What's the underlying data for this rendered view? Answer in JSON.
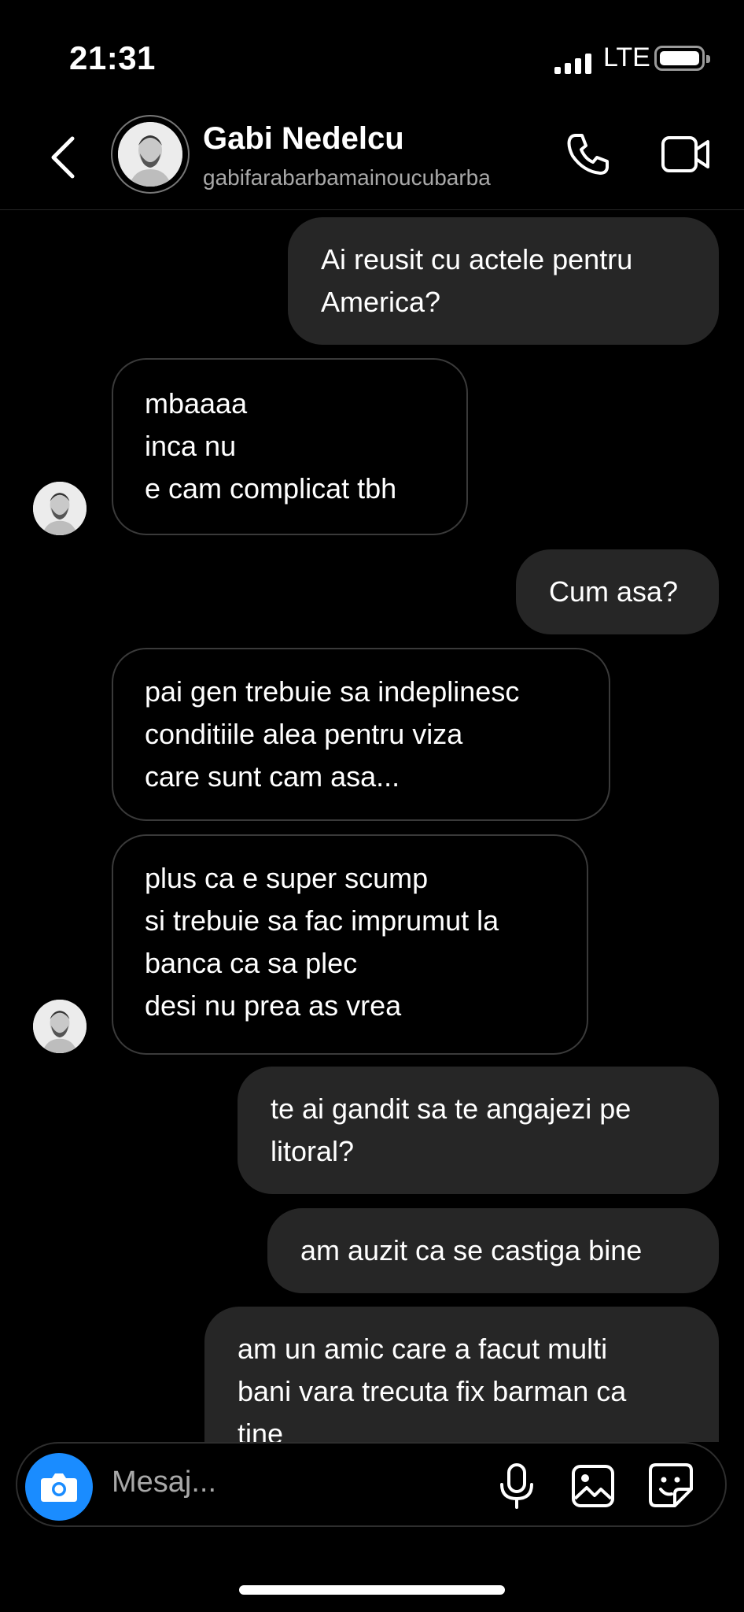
{
  "status_bar": {
    "time": "21:31",
    "network": "LTE"
  },
  "header": {
    "name": "Gabi Nedelcu",
    "handle": "gabifarabarbamainoucubarba"
  },
  "messages": [
    {
      "from": "me",
      "lines": [
        "Ai reusit cu actele pentru",
        "America?"
      ]
    },
    {
      "from": "them",
      "lines": [
        "mbaaaa",
        "inca nu",
        "e cam complicat tbh"
      ]
    },
    {
      "from": "me",
      "lines": [
        "Cum asa?"
      ]
    },
    {
      "from": "them",
      "lines": [
        "pai gen trebuie sa indeplinesc",
        "conditiile alea pentru viza",
        "care sunt cam asa..."
      ]
    },
    {
      "from": "them",
      "lines": [
        "plus ca e super scump",
        "si trebuie sa fac imprumut la",
        "banca ca sa plec",
        "desi nu prea as vrea"
      ]
    },
    {
      "from": "me",
      "lines": [
        "te ai gandit sa te angajezi pe",
        "litoral?"
      ]
    },
    {
      "from": "me",
      "lines": [
        "am auzit ca se castiga bine"
      ]
    },
    {
      "from": "me",
      "lines": [
        "am un amic care a facut multi",
        "bani vara trecuta fix barman ca",
        "tine"
      ]
    }
  ],
  "composer": {
    "placeholder": "Mesaj..."
  },
  "colors": {
    "background": "#000000",
    "sent_bubble": "#262626",
    "camera_button": "#1a8cff",
    "secondary_text": "#a8a8a8"
  },
  "icons": [
    "back-chevron-icon",
    "phone-icon",
    "video-camera-icon",
    "camera-icon",
    "microphone-icon",
    "gallery-icon",
    "sticker-icon"
  ]
}
